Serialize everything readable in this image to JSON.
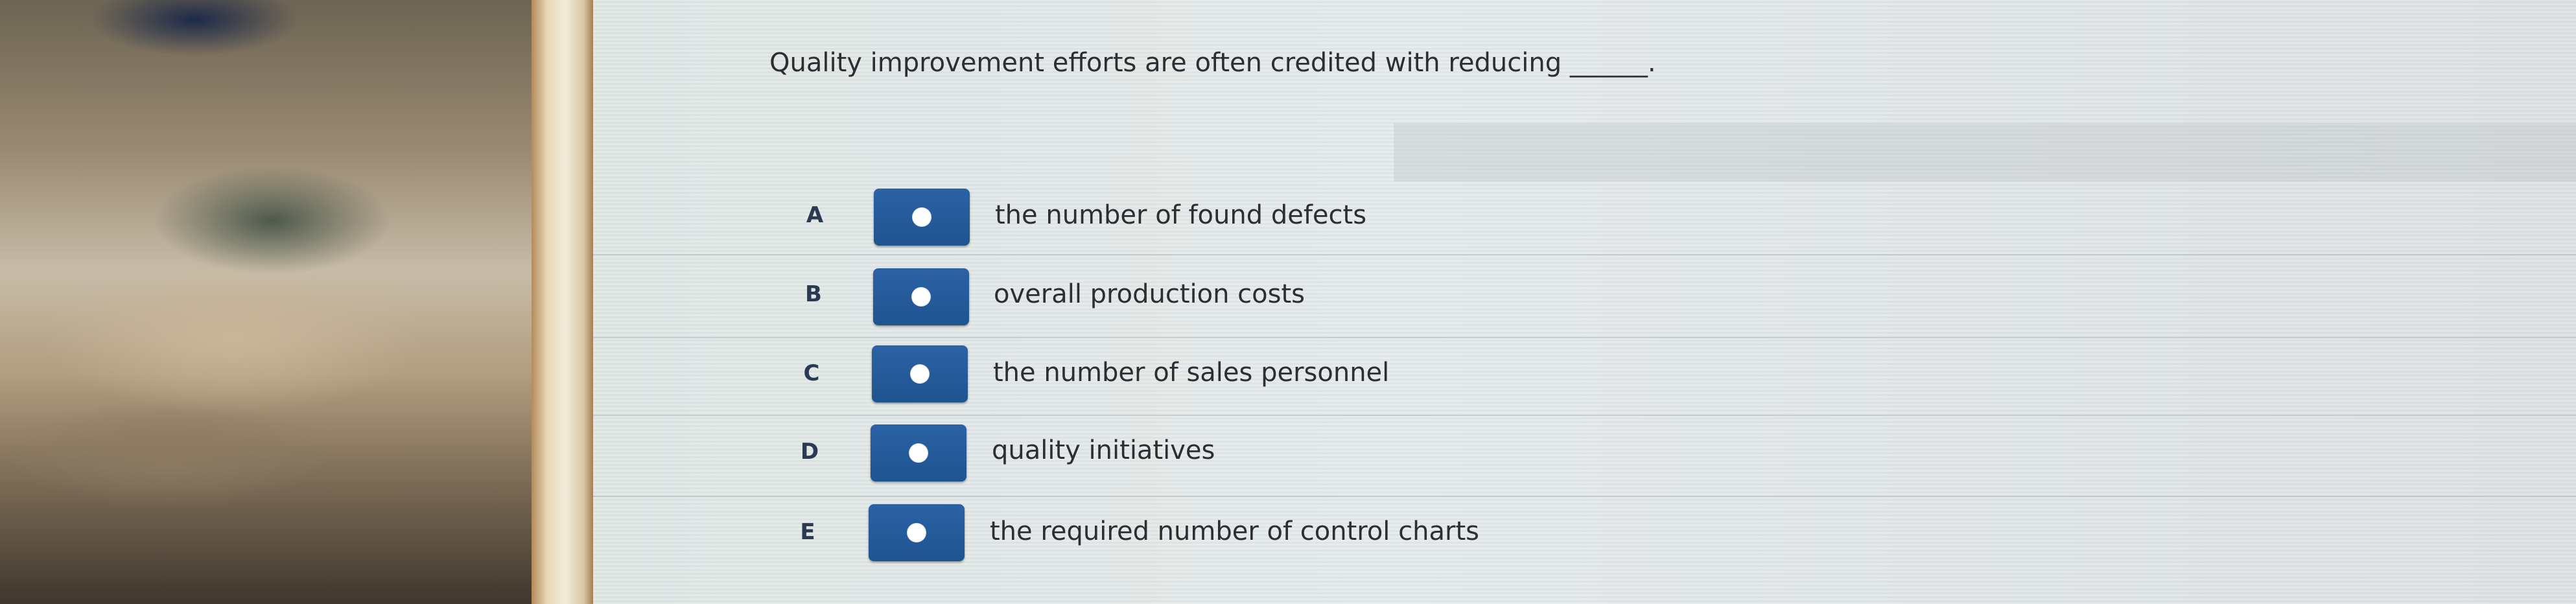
{
  "question": {
    "prompt": "Quality improvement efforts are often credited with reducing ______."
  },
  "options": [
    {
      "letter": "A",
      "text": "the number of found defects"
    },
    {
      "letter": "B",
      "text": "overall production costs"
    },
    {
      "letter": "C",
      "text": "the number of sales personnel"
    },
    {
      "letter": "D",
      "text": "quality initiatives"
    },
    {
      "letter": "E",
      "text": "the required number of control charts"
    }
  ],
  "colors": {
    "radio_button": "#1e548f",
    "text": "#2b2f33"
  }
}
